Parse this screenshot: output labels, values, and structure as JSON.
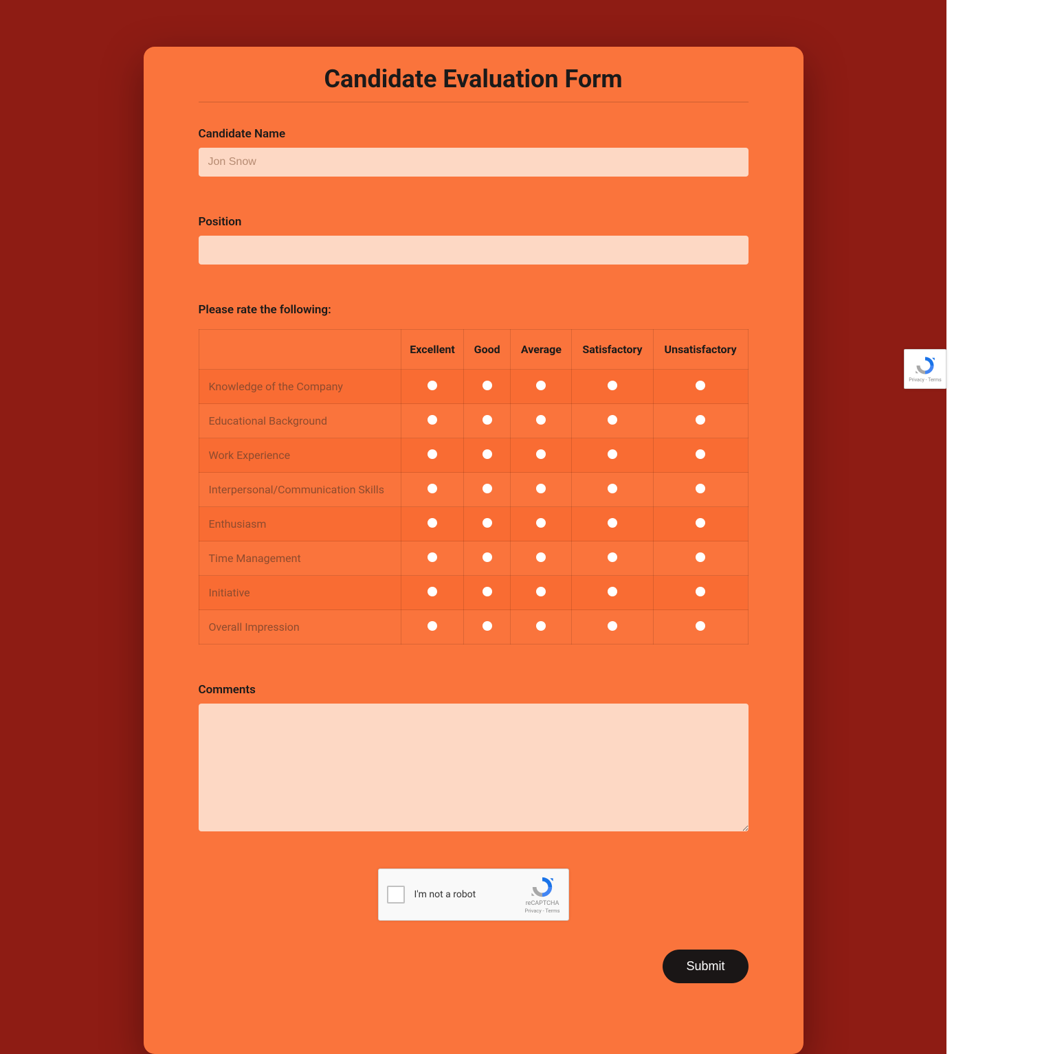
{
  "form": {
    "title": "Candidate Evaluation Form",
    "candidate_name": {
      "label": "Candidate Name",
      "placeholder": "Jon Snow",
      "value": ""
    },
    "position": {
      "label": "Position",
      "placeholder": "",
      "value": ""
    },
    "rating": {
      "prompt": "Please rate the following:",
      "columns": [
        "Excellent",
        "Good",
        "Average",
        "Satisfactory",
        "Unsatisfactory"
      ],
      "rows": [
        "Knowledge of the Company",
        "Educational Background",
        "Work Experience",
        "Interpersonal/Communication Skills",
        "Enthusiasm",
        "Time Management",
        "Initiative",
        "Overall Impression"
      ]
    },
    "comments": {
      "label": "Comments",
      "value": ""
    },
    "captcha": {
      "label": "I'm not a robot",
      "brand": "reCAPTCHA",
      "links": "Privacy - Terms"
    },
    "submit_label": "Submit"
  }
}
